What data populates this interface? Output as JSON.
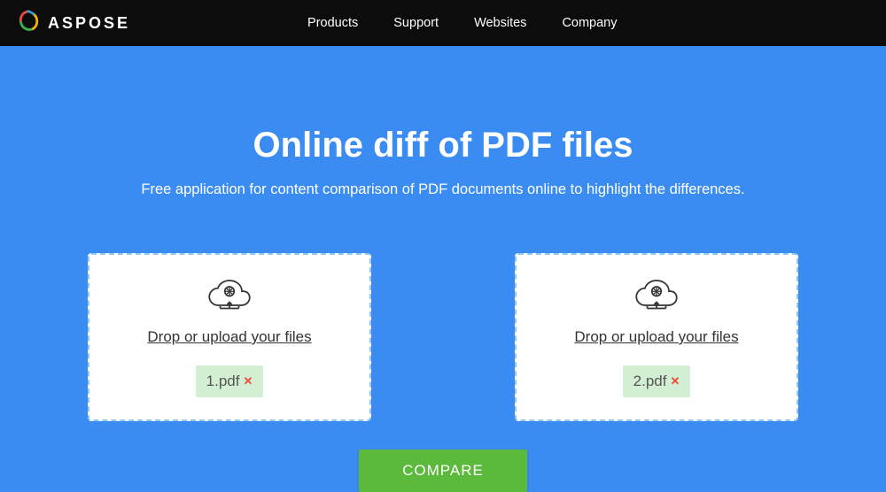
{
  "brand": {
    "name": "ASPOSE"
  },
  "nav": {
    "items": [
      "Products",
      "Support",
      "Websites",
      "Company"
    ]
  },
  "hero": {
    "title": "Online diff of PDF files",
    "subtitle": "Free application for content comparison of PDF documents online to highlight the differences."
  },
  "dropzone": {
    "left": {
      "label": "Drop or upload your files",
      "file_name": "1.pdf"
    },
    "right": {
      "label": "Drop or upload your files",
      "file_name": "2.pdf"
    }
  },
  "actions": {
    "compare_label": "COMPARE"
  },
  "colors": {
    "navbar_bg": "#0c0c0c",
    "page_bg": "#3b8cf2",
    "drop_border": "#8fc9ef",
    "chip_bg": "#d3efd3",
    "compare_bg": "#5bba3b"
  }
}
